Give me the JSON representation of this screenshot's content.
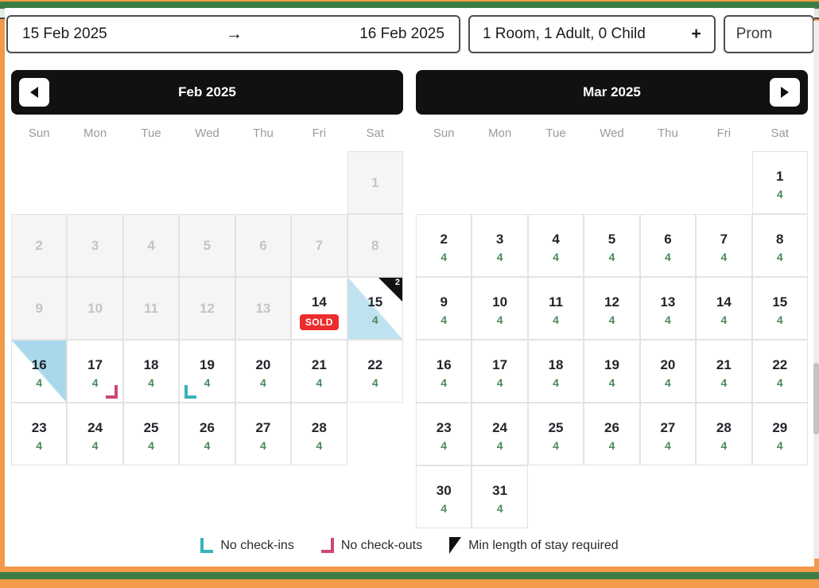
{
  "theme": {
    "frame_orange": "#f2994a",
    "bar_green": "#3a7d44",
    "header_black": "#111111",
    "selection_blue": "#bfe2f0",
    "available_green": "#4a8a5a",
    "sold_red": "#ec2d2d",
    "no_checkin_teal": "#36b3b8",
    "no_checkout_pink": "#cd4878"
  },
  "searchbar": {
    "date_range": {
      "start": "15 Feb 2025",
      "arrow": "→",
      "end": "16 Feb 2025"
    },
    "occupancy": {
      "value": "1 Room, 1 Adult, 0 Child",
      "plus": "+"
    },
    "promo": {
      "value": "Prom"
    }
  },
  "weekdays": [
    "Sun",
    "Mon",
    "Tue",
    "Wed",
    "Thu",
    "Fri",
    "Sat"
  ],
  "calendars": [
    {
      "title": "Feb 2025",
      "nav": "prev",
      "lead_blanks": 6,
      "days": [
        {
          "num": "1",
          "disabled": true
        },
        {
          "num": "2",
          "disabled": true
        },
        {
          "num": "3",
          "disabled": true
        },
        {
          "num": "4",
          "disabled": true
        },
        {
          "num": "5",
          "disabled": true
        },
        {
          "num": "6",
          "disabled": true
        },
        {
          "num": "7",
          "disabled": true
        },
        {
          "num": "8",
          "disabled": true
        },
        {
          "num": "9",
          "disabled": true
        },
        {
          "num": "10",
          "disabled": true
        },
        {
          "num": "11",
          "disabled": true
        },
        {
          "num": "12",
          "disabled": true
        },
        {
          "num": "13",
          "disabled": true
        },
        {
          "num": "14",
          "sold": "SOLD"
        },
        {
          "num": "15",
          "avail": "4",
          "selection": "start",
          "min_stay": "2"
        },
        {
          "num": "16",
          "avail": "4",
          "selection": "end"
        },
        {
          "num": "17",
          "avail": "4",
          "no_checkout": true
        },
        {
          "num": "18",
          "avail": "4"
        },
        {
          "num": "19",
          "avail": "4",
          "no_checkin": true
        },
        {
          "num": "20",
          "avail": "4"
        },
        {
          "num": "21",
          "avail": "4"
        },
        {
          "num": "22",
          "avail": "4"
        },
        {
          "num": "23",
          "avail": "4"
        },
        {
          "num": "24",
          "avail": "4"
        },
        {
          "num": "25",
          "avail": "4"
        },
        {
          "num": "26",
          "avail": "4"
        },
        {
          "num": "27",
          "avail": "4"
        },
        {
          "num": "28",
          "avail": "4"
        }
      ]
    },
    {
      "title": "Mar 2025",
      "nav": "next",
      "lead_blanks": 6,
      "days": [
        {
          "num": "1",
          "avail": "4"
        },
        {
          "num": "2",
          "avail": "4"
        },
        {
          "num": "3",
          "avail": "4"
        },
        {
          "num": "4",
          "avail": "4"
        },
        {
          "num": "5",
          "avail": "4"
        },
        {
          "num": "6",
          "avail": "4"
        },
        {
          "num": "7",
          "avail": "4"
        },
        {
          "num": "8",
          "avail": "4"
        },
        {
          "num": "9",
          "avail": "4"
        },
        {
          "num": "10",
          "avail": "4"
        },
        {
          "num": "11",
          "avail": "4"
        },
        {
          "num": "12",
          "avail": "4"
        },
        {
          "num": "13",
          "avail": "4"
        },
        {
          "num": "14",
          "avail": "4"
        },
        {
          "num": "15",
          "avail": "4"
        },
        {
          "num": "16",
          "avail": "4"
        },
        {
          "num": "17",
          "avail": "4"
        },
        {
          "num": "18",
          "avail": "4"
        },
        {
          "num": "19",
          "avail": "4"
        },
        {
          "num": "20",
          "avail": "4"
        },
        {
          "num": "21",
          "avail": "4"
        },
        {
          "num": "22",
          "avail": "4"
        },
        {
          "num": "23",
          "avail": "4"
        },
        {
          "num": "24",
          "avail": "4"
        },
        {
          "num": "25",
          "avail": "4"
        },
        {
          "num": "26",
          "avail": "4"
        },
        {
          "num": "27",
          "avail": "4"
        },
        {
          "num": "28",
          "avail": "4"
        },
        {
          "num": "29",
          "avail": "4"
        },
        {
          "num": "30",
          "avail": "4"
        },
        {
          "num": "31",
          "avail": "4"
        }
      ]
    }
  ],
  "legend": [
    {
      "marker": "no-checkin-bracket",
      "label": "No check-ins"
    },
    {
      "marker": "no-checkout-bracket",
      "label": "No check-outs"
    },
    {
      "marker": "min-stay-triangle",
      "label": "Min length of stay required"
    }
  ]
}
